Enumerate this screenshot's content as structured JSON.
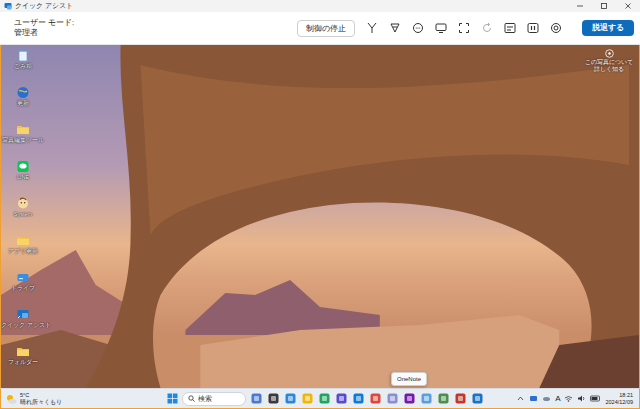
{
  "window": {
    "title": "クイック アシスト"
  },
  "toolbar": {
    "mode_label": "ユーザー モード:",
    "mode_value": "管理者",
    "stop_button": "制御の停止",
    "leave_button": "脱退する",
    "tools": [
      {
        "disabled": false
      },
      {
        "disabled": false
      },
      {
        "disabled": false
      },
      {
        "disabled": false
      },
      {
        "disabled": false
      },
      {
        "disabled": true
      },
      {
        "disabled": false
      },
      {
        "disabled": false
      },
      {
        "disabled": false
      }
    ]
  },
  "desktop": {
    "icons": [
      {
        "label": "ごみ箱",
        "kind": "trash"
      },
      {
        "label": "更新",
        "kind": "globe"
      },
      {
        "label": "写真編集ツール",
        "kind": "folder"
      },
      {
        "label": "LINE",
        "kind": "chat"
      },
      {
        "label": "System",
        "kind": "face"
      },
      {
        "label": "アプリ更新",
        "kind": "folder"
      },
      {
        "label": "ドライブ",
        "kind": "drive"
      },
      {
        "label": "クイック アシスト",
        "kind": "assist"
      },
      {
        "label": "フォルダー",
        "kind": "folder"
      }
    ],
    "spotlight": "この写真について詳しく知る"
  },
  "taskbar": {
    "weather": {
      "temp": "5°C",
      "condition": "晴れ所々くもり"
    },
    "search": "検索",
    "tooltip": "OneNote",
    "ime": "A",
    "time": "18:21",
    "date": "2024/12/09"
  }
}
